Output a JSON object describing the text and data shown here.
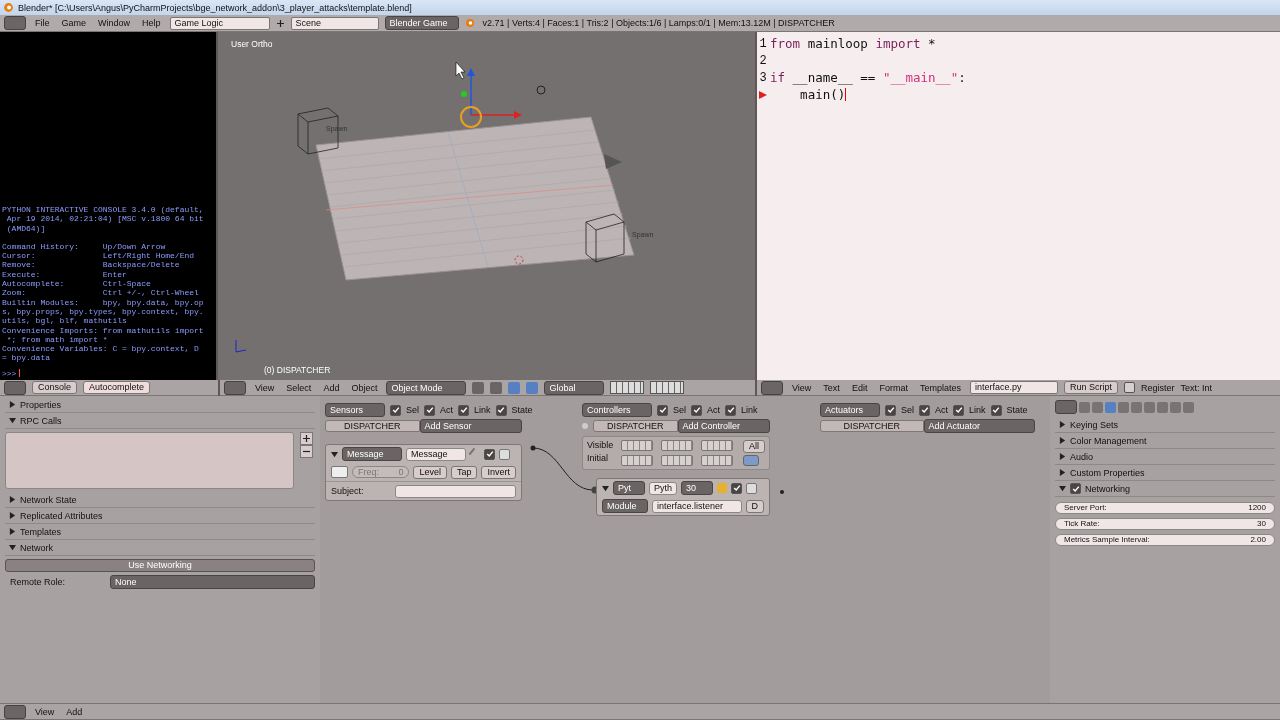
{
  "title_bar": {
    "title": "Blender* [C:\\Users\\Angus\\PyCharmProjects\\bge_network_addon\\3_player_attacks\\template.blend]"
  },
  "info_header": {
    "menus": [
      "File",
      "Game",
      "Window",
      "Help"
    ],
    "screen_layout": "Game Logic",
    "scene": "Scene",
    "render_engine": "Blender Game",
    "stats": "v2.71 | Verts:4 | Faces:1 | Tris:2 | Objects:1/6 | Lamps:0/1 | Mem:13.12M | DISPATCHER"
  },
  "console": {
    "blocks": [
      [
        "PYTHON INTERACTIVE CONSOLE 3.4.0 (default,",
        " Apr 19 2014, 02:21:04) [MSC v.1800 64 bit",
        " (AMD64)]"
      ],
      [
        "Command History:     Up/Down Arrow",
        "Cursor:              Left/Right Home/End",
        "Remove:              Backspace/Delete",
        "Execute:             Enter",
        "Autocomplete:        Ctrl-Space",
        "Zoom:                Ctrl +/-, Ctrl-Wheel",
        "Builtin Modules:     bpy, bpy.data, bpy.op",
        "s, bpy.props, bpy.types, bpy.context, bpy.",
        "utils, bgl, blf, mathutils",
        "Convenience Imports: from mathutils import",
        " *; from math import *",
        "Convenience Variables: C = bpy.context, D",
        "= bpy.data"
      ]
    ],
    "prompt": ">>>"
  },
  "viewport": {
    "view_label": "User Ortho",
    "object_label": "(0) DISPATCHER",
    "spawn_labels": [
      "Spawn",
      "Spawn"
    ]
  },
  "text_editor": {
    "lines": [
      {
        "number": "1",
        "error": false,
        "tokens": [
          {
            "kind": "keyword",
            "text": "from"
          },
          {
            "kind": "plain",
            "text": " mainloop "
          },
          {
            "kind": "keyword",
            "text": "import"
          },
          {
            "kind": "plain",
            "text": " *"
          }
        ]
      },
      {
        "number": "2",
        "error": false
      },
      {
        "number": "3",
        "error": false,
        "tokens": [
          {
            "kind": "keyword",
            "text": "if"
          },
          {
            "kind": "plain",
            "text": " __name__ == "
          },
          {
            "kind": "string",
            "text": "\"__main__\""
          },
          {
            "kind": "plain",
            "text": ":"
          }
        ]
      },
      {
        "error": true,
        "tokens": [
          {
            "kind": "plain",
            "text": "    main()"
          }
        ]
      }
    ]
  },
  "console_header": {
    "buttons": [
      "Console",
      "Autocomplete"
    ]
  },
  "viewport_header": {
    "menus": [
      "View",
      "Select",
      "Add",
      "Object"
    ],
    "mode": "Object Mode",
    "orientation": "Global"
  },
  "text_header": {
    "menus": [
      "View",
      "Text",
      "Edit",
      "Format",
      "Templates"
    ],
    "file": "interface.py",
    "run_button": "Run Script",
    "register": {
      "label": "Register",
      "checked": false
    },
    "cut_label": "Text: Int"
  },
  "left_properties": {
    "panels": [
      {
        "title": "Properties",
        "expanded": false
      },
      {
        "title": "RPC Calls",
        "expanded": true,
        "kind": "list"
      },
      {
        "title": "Network State",
        "expanded": false
      },
      {
        "title": "Replicated Attributes",
        "expanded": false
      },
      {
        "title": "Templates",
        "expanded": false
      },
      {
        "title": "Network",
        "expanded": true,
        "kind": "network"
      }
    ],
    "use_networking": "Use Networking",
    "remote_role_label": "Remote Role:",
    "remote_role": "None"
  },
  "logic": {
    "sensors": {
      "menu": "Sensors",
      "filters": [
        {
          "label": "Sel",
          "checked": true
        },
        {
          "label": "Act",
          "checked": true
        },
        {
          "label": "Link",
          "checked": true
        },
        {
          "label": "State",
          "checked": true
        }
      ],
      "object": "DISPATCHER",
      "add": "Add Sensor",
      "brick": {
        "type": "Message",
        "name": "Message",
        "enabled": true,
        "freq_label": "Freq:",
        "freq": "0",
        "level": "Level",
        "tap": "Tap",
        "invert": "Invert",
        "subject_label": "Subject:"
      }
    },
    "controllers": {
      "menu": "Controllers",
      "filters": [
        {
          "label": "Sel",
          "checked": true
        },
        {
          "label": "Act",
          "checked": true
        },
        {
          "label": "Link",
          "checked": true
        }
      ],
      "object": "DISPATCHER",
      "add": "Add Controller",
      "state_labels": [
        "Visible",
        "Initial"
      ],
      "all": "All",
      "brick": {
        "type": "Pyt",
        "name": "Pyth",
        "priority": "30",
        "enabled": true,
        "mode": "Module",
        "module": "interface.listener",
        "debug": "D"
      }
    },
    "actuators": {
      "menu": "Actuators",
      "filters": [
        {
          "label": "Sel",
          "checked": true
        },
        {
          "label": "Act",
          "checked": true
        },
        {
          "label": "Link",
          "checked": true
        },
        {
          "label": "State",
          "checked": true
        }
      ],
      "object": "DISPATCHER",
      "add": "Add Actuator"
    }
  },
  "right_properties": {
    "panels": [
      {
        "title": "Keying Sets",
        "expanded": false
      },
      {
        "title": "Color Management",
        "expanded": false
      },
      {
        "title": "Audio",
        "expanded": false
      },
      {
        "title": "Custom Properties",
        "expanded": false
      },
      {
        "title": "Networking",
        "expanded": true,
        "checked": true
      }
    ],
    "fields": [
      {
        "label": "Server Port:",
        "value": "1200"
      },
      {
        "label": "Tick Rate:",
        "value": "30"
      },
      {
        "label": "Metrics Sample Interval:",
        "value": "2.00"
      }
    ]
  },
  "bottom_header": {
    "menus": [
      "View",
      "Add"
    ]
  }
}
